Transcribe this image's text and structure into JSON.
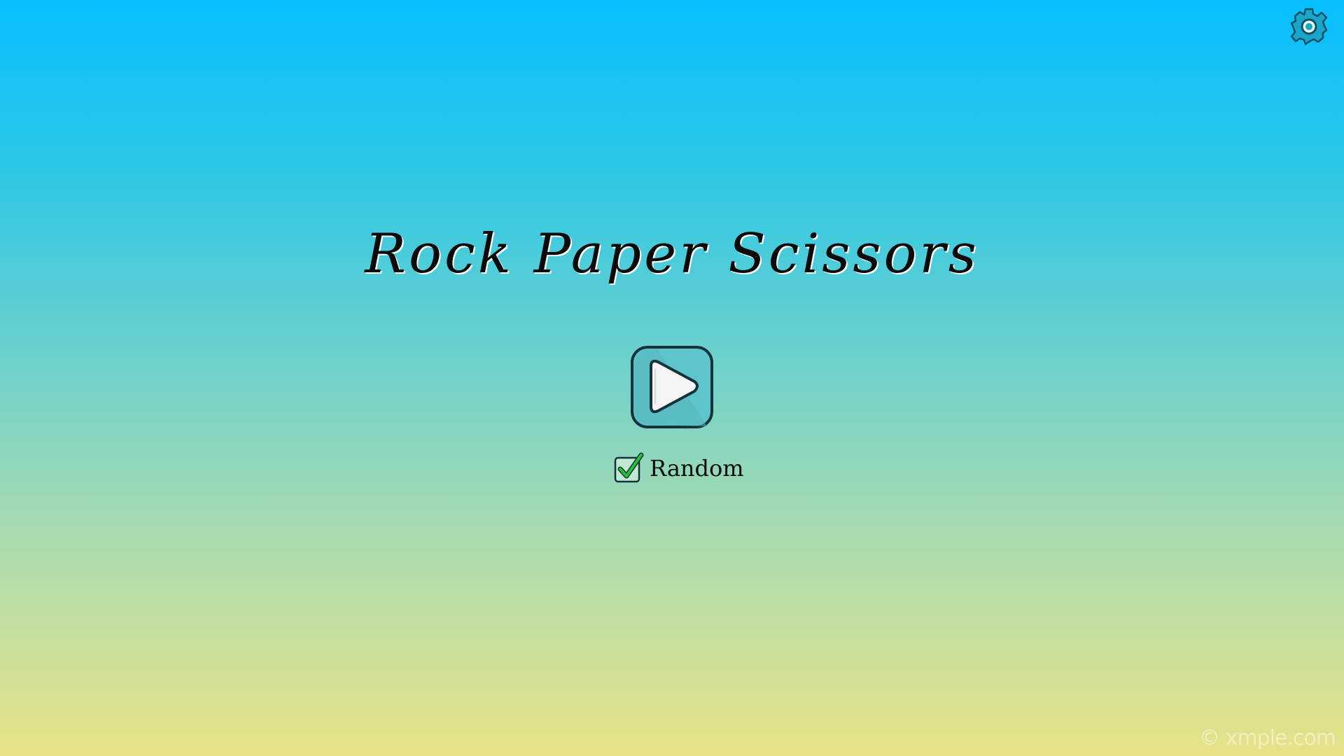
{
  "game": {
    "title": "Rock Paper Scissors"
  },
  "settings": {
    "icon": "gear-icon",
    "color": "#1aa6c8"
  },
  "play_button": {
    "icon": "play-icon",
    "color": "#5fc5cc"
  },
  "random_option": {
    "label": "Random",
    "checked": true,
    "check_color": "#22c13a"
  },
  "watermark": {
    "text": "© xmple.com"
  }
}
